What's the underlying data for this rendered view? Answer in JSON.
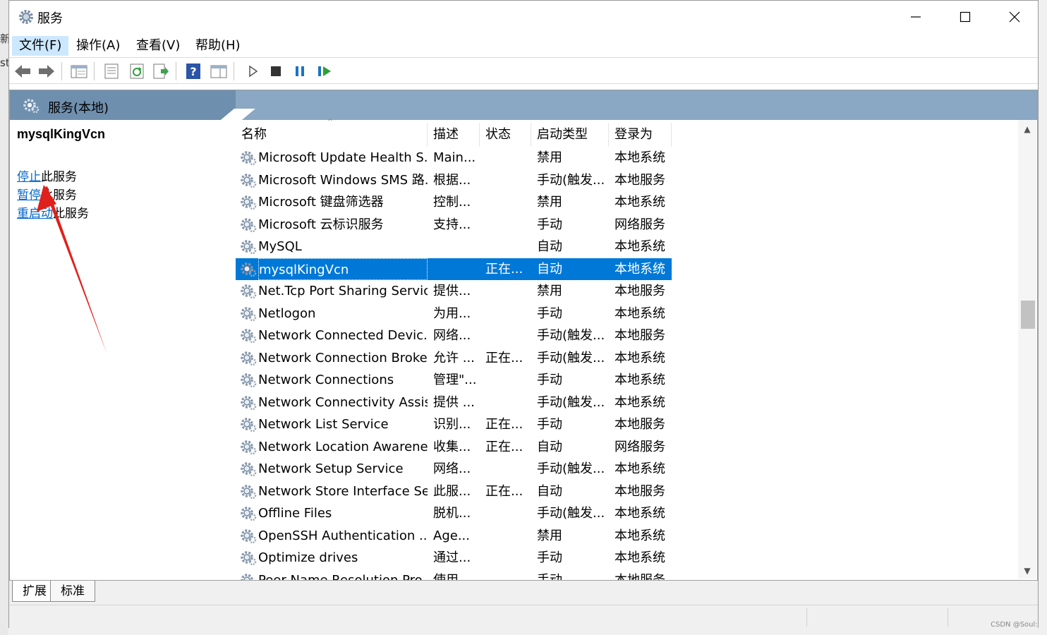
{
  "window": {
    "title": "服务"
  },
  "menu": [
    {
      "label": "文件(F)"
    },
    {
      "label": "操作(A)"
    },
    {
      "label": "查看(V)"
    },
    {
      "label": "帮助(H)"
    }
  ],
  "toolbar": {
    "icons": [
      "back-icon",
      "forward-icon",
      "console-tree-icon",
      "properties-icon",
      "refresh-icon",
      "export-list-icon",
      "help-icon",
      "view-icon",
      "start-icon",
      "stop-icon",
      "pause-icon",
      "resume-icon"
    ]
  },
  "scope": {
    "title": "服务(本地)"
  },
  "left": {
    "service_name": "mysqlKingVcn",
    "actions": [
      {
        "link": "停止",
        "rest": "此服务"
      },
      {
        "link": "暂停",
        "rest": "此服务"
      },
      {
        "link": "重启动",
        "rest": "此服务"
      }
    ]
  },
  "columns": [
    "名称",
    "描述",
    "状态",
    "启动类型",
    "登录为"
  ],
  "rows": [
    {
      "name": "Microsoft Update Health S...",
      "desc": "Main...",
      "status": "",
      "startup": "禁用",
      "logon": "本地系统"
    },
    {
      "name": "Microsoft Windows SMS 路...",
      "desc": "根据...",
      "status": "",
      "startup": "手动(触发...",
      "logon": "本地服务"
    },
    {
      "name": "Microsoft 键盘筛选器",
      "desc": "控制...",
      "status": "",
      "startup": "禁用",
      "logon": "本地系统"
    },
    {
      "name": "Microsoft 云标识服务",
      "desc": "支持...",
      "status": "",
      "startup": "手动",
      "logon": "网络服务"
    },
    {
      "name": "MySQL",
      "desc": "",
      "status": "",
      "startup": "自动",
      "logon": "本地系统"
    },
    {
      "name": "mysqlKingVcn",
      "desc": "",
      "status": "正在...",
      "startup": "自动",
      "logon": "本地系统",
      "selected": true
    },
    {
      "name": "Net.Tcp Port Sharing Service",
      "desc": "提供...",
      "status": "",
      "startup": "禁用",
      "logon": "本地服务"
    },
    {
      "name": "Netlogon",
      "desc": "为用...",
      "status": "",
      "startup": "手动",
      "logon": "本地系统"
    },
    {
      "name": "Network Connected Devic...",
      "desc": "网络...",
      "status": "",
      "startup": "手动(触发...",
      "logon": "本地服务"
    },
    {
      "name": "Network Connection Broker",
      "desc": "允许 ...",
      "status": "正在...",
      "startup": "手动(触发...",
      "logon": "本地系统"
    },
    {
      "name": "Network Connections",
      "desc": "管理\"...",
      "status": "",
      "startup": "手动",
      "logon": "本地系统"
    },
    {
      "name": "Network Connectivity Assis...",
      "desc": "提供 ...",
      "status": "",
      "startup": "手动(触发...",
      "logon": "本地系统"
    },
    {
      "name": "Network List Service",
      "desc": "识别...",
      "status": "正在...",
      "startup": "手动",
      "logon": "本地服务"
    },
    {
      "name": "Network Location Awarene...",
      "desc": "收集...",
      "status": "正在...",
      "startup": "自动",
      "logon": "网络服务"
    },
    {
      "name": "Network Setup Service",
      "desc": "网络...",
      "status": "",
      "startup": "手动(触发...",
      "logon": "本地系统"
    },
    {
      "name": "Network Store Interface Se...",
      "desc": "此服...",
      "status": "正在...",
      "startup": "自动",
      "logon": "本地服务"
    },
    {
      "name": "Offline Files",
      "desc": "脱机...",
      "status": "",
      "startup": "手动(触发...",
      "logon": "本地系统"
    },
    {
      "name": "OpenSSH Authentication ...",
      "desc": "Age...",
      "status": "",
      "startup": "禁用",
      "logon": "本地系统"
    },
    {
      "name": "Optimize drives",
      "desc": "通过...",
      "status": "",
      "startup": "手动",
      "logon": "本地系统"
    },
    {
      "name": "Peer Name Resolution Pro...",
      "desc": "使用...",
      "status": "",
      "startup": "手动",
      "logon": "本地服务"
    }
  ],
  "tabs": [
    {
      "label": "扩展"
    },
    {
      "label": "标准"
    }
  ],
  "watermark": "CSDN @Soul:",
  "background_text": [
    "新",
    "st"
  ],
  "colors": {
    "selection": "#0078d7",
    "link": "#0066cc",
    "header_bar": "#8aa7c3",
    "arrow": "#e0201b"
  }
}
